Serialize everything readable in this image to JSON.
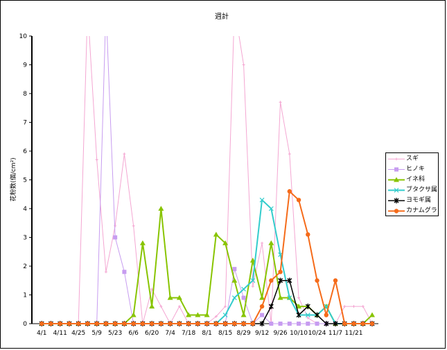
{
  "chart_data": {
    "type": "line",
    "title": "週計",
    "ylabel": "花粉数(個/cm²)",
    "xlabel": "",
    "ylim": [
      0,
      10
    ],
    "yticks": [
      "0",
      "1",
      "2",
      "3",
      "4",
      "5",
      "6",
      "7",
      "8",
      "9",
      "10"
    ],
    "grid": false,
    "legend_position": "right",
    "x_labels": [
      "4/1",
      "4/11",
      "4/25",
      "5/9",
      "5/23",
      "6/6",
      "6/20",
      "7/4",
      "7/18",
      "8/1",
      "8/15",
      "8/29",
      "9/12",
      "9/26",
      "10/10",
      "10/24",
      "11/7",
      "11/21"
    ],
    "series": [
      {
        "name": "スギ",
        "color": "#f4a6d2",
        "marker": "plus",
        "line_width": 1,
        "values": [
          0,
          0,
          0,
          0,
          0,
          11,
          5.7,
          1.8,
          3.4,
          5.9,
          3.4,
          0,
          1.2,
          0.6,
          0,
          0.6,
          0,
          0,
          0,
          0.25,
          0.6,
          11,
          9,
          1.3,
          2.8,
          0,
          7.7,
          5.9,
          0.9,
          0.2,
          0,
          0,
          0,
          0.6,
          0.6,
          0.6,
          0
        ]
      },
      {
        "name": "ヒノキ",
        "color": "#c79cf0",
        "marker": "square",
        "line_width": 1,
        "values": [
          0,
          0,
          0,
          0,
          0,
          0,
          0,
          11,
          3.0,
          1.8,
          0,
          0,
          0,
          0,
          0,
          0,
          0,
          0,
          0,
          0,
          0,
          1.9,
          0.9,
          0,
          0.3,
          0,
          0,
          0,
          0,
          0,
          0,
          0,
          0,
          0,
          0,
          0,
          0
        ]
      },
      {
        "name": "イネ科",
        "color": "#88c400",
        "marker": "triangle",
        "line_width": 2,
        "values": [
          0,
          0,
          0,
          0,
          0,
          0,
          0,
          0,
          0,
          0,
          0.3,
          2.8,
          0.6,
          4.0,
          0.9,
          0.9,
          0.3,
          0.3,
          0.3,
          3.1,
          2.8,
          1.5,
          0.3,
          2.2,
          0.9,
          2.8,
          0.9,
          0.9,
          0.6,
          0.6,
          0.3,
          0.6,
          0,
          0,
          0,
          0,
          0.3
        ]
      },
      {
        "name": "ブタクサ属",
        "color": "#33cccc",
        "marker": "asterisk",
        "line_width": 2,
        "values": [
          0,
          0,
          0,
          0,
          0,
          0,
          0,
          0,
          0,
          0,
          0,
          0,
          0,
          0,
          0,
          0,
          0,
          0,
          0,
          0,
          0.3,
          0.9,
          1.2,
          1.5,
          4.3,
          4.0,
          2.4,
          0.9,
          0.3,
          0.3,
          0.3,
          0.6,
          0,
          0,
          0,
          0,
          0
        ]
      },
      {
        "name": "ヨモギ属",
        "color": "#000000",
        "marker": "star",
        "line_width": 1.5,
        "values": [
          0,
          0,
          0,
          0,
          0,
          0,
          0,
          0,
          0,
          0,
          0,
          0,
          0,
          0,
          0,
          0,
          0,
          0,
          0,
          0,
          0,
          0,
          0,
          0,
          0,
          0.6,
          1.5,
          1.5,
          0.3,
          0.6,
          0.3,
          0,
          0,
          0,
          0,
          0,
          0
        ]
      },
      {
        "name": "カナムグラ",
        "color": "#f56b1a",
        "marker": "circle",
        "line_width": 2,
        "values": [
          0,
          0,
          0,
          0,
          0,
          0,
          0,
          0,
          0,
          0,
          0,
          0,
          0,
          0,
          0,
          0,
          0,
          0,
          0,
          0,
          0,
          0,
          0,
          0,
          0.6,
          1.5,
          1.8,
          4.6,
          4.3,
          3.1,
          1.5,
          0.3,
          1.5,
          0,
          0,
          0,
          0
        ]
      }
    ]
  }
}
